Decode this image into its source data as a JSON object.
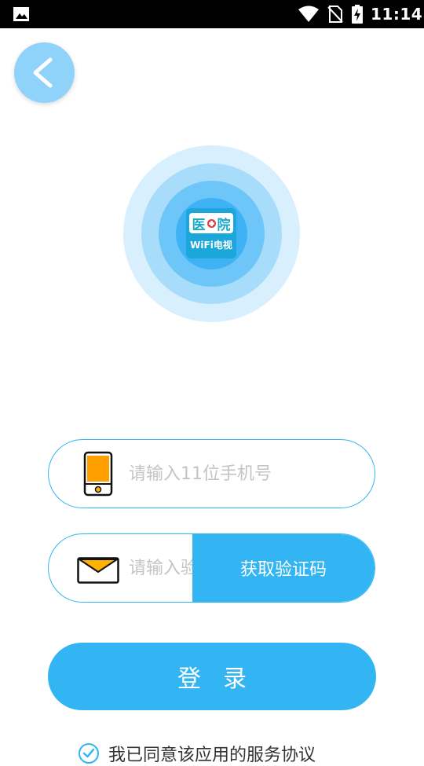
{
  "status_bar": {
    "time": "11:14",
    "icons": [
      "gallery-icon",
      "wifi-icon",
      "no-sim-icon",
      "battery-charging-icon"
    ]
  },
  "header": {
    "back_icon": "chevron-left-icon"
  },
  "logo": {
    "top_text_left": "医",
    "top_text_right": "院",
    "bottom_text": "WiFi电视"
  },
  "form": {
    "phone_placeholder": "请输入11位手机号",
    "phone_value": "",
    "code_placeholder": "请输入验证码",
    "code_value": "",
    "get_code_label": "获取验证码",
    "login_label": "登录"
  },
  "agreement": {
    "text": "我已同意该应用的服务协议",
    "checked": true
  },
  "colors": {
    "primary": "#33b5f4",
    "back_button": "#8fd3fb",
    "placeholder": "#c4c4c4",
    "phone_screen": "#ff9f00",
    "envelope_flap": "#ffb300"
  }
}
